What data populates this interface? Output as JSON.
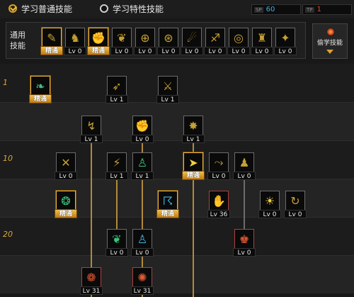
{
  "tabs": [
    {
      "label": "学习普通技能",
      "selected": true
    },
    {
      "label": "学习特性技能",
      "selected": false
    }
  ],
  "points": [
    {
      "tag": "SP",
      "value": "60",
      "color": "#4aa8e0"
    },
    {
      "tag": "TP",
      "value": "1",
      "color": "#e04a2a"
    }
  ],
  "general": {
    "title": "通用技能",
    "skills": [
      {
        "icon": "scroll-pen-icon",
        "glyph": "✎",
        "label": "精通",
        "mastered": true
      },
      {
        "icon": "flame-knight-icon",
        "glyph": "♞",
        "label": "Lv 0"
      },
      {
        "icon": "fist-strike-icon",
        "glyph": "✊",
        "label": "精通",
        "mastered": true
      },
      {
        "icon": "phoenix-icon",
        "glyph": "❦",
        "label": "Lv 0"
      },
      {
        "icon": "target-icon",
        "glyph": "⊕",
        "label": "Lv 0"
      },
      {
        "icon": "crosshair-icon",
        "glyph": "⊛",
        "label": "Lv 0"
      },
      {
        "icon": "leap-icon",
        "glyph": "☄",
        "label": "Lv 0"
      },
      {
        "icon": "runner-icon",
        "glyph": "♐",
        "label": "Lv 0"
      },
      {
        "icon": "spiral-icon",
        "glyph": "◎",
        "label": "Lv 0"
      },
      {
        "icon": "warrior-icon",
        "glyph": "♜",
        "label": "Lv 0"
      },
      {
        "icon": "aura-man-icon",
        "glyph": "✦",
        "label": "Lv 0"
      }
    ]
  },
  "steal": {
    "label": "偷学技能"
  },
  "levels": [
    "1",
    "10",
    "20"
  ],
  "tree": [
    {
      "icon": "leaf-spirit-icon",
      "glyph": "❧",
      "label": "精通",
      "mastered": true,
      "tone": "gr"
    },
    {
      "icon": "kick-icon",
      "glyph": "➶",
      "label": "Lv 1",
      "tone": "g"
    },
    {
      "icon": "slash-icon",
      "glyph": "⚔",
      "label": "Lv 1",
      "tone": "g"
    },
    {
      "icon": "wind-kick-icon",
      "glyph": "↯",
      "label": "Lv 1",
      "tone": "g"
    },
    {
      "icon": "uppercut-icon",
      "glyph": "✊",
      "label": "Lv 0",
      "tone": "g"
    },
    {
      "icon": "burst-icon",
      "glyph": "✸",
      "label": "Lv 1",
      "tone": "g"
    },
    {
      "icon": "cross-strike-icon",
      "glyph": "✕",
      "label": "Lv 0",
      "tone": "g"
    },
    {
      "icon": "lightning-icon",
      "glyph": "⚡",
      "label": "Lv 1",
      "tone": "g"
    },
    {
      "icon": "body-power-icon",
      "glyph": "♙",
      "label": "Lv 1",
      "tone": "gr"
    },
    {
      "icon": "dash-icon",
      "glyph": "➤",
      "label": "精通",
      "mastered": true,
      "tone": "yl"
    },
    {
      "icon": "slide-icon",
      "glyph": "⤳",
      "label": "Lv 0",
      "tone": "g"
    },
    {
      "icon": "grab-icon",
      "glyph": "♟",
      "label": "Lv 0",
      "tone": "g"
    },
    {
      "icon": "energy-wave-icon",
      "glyph": "❂",
      "label": "精通",
      "mastered": true,
      "tone": "gr"
    },
    {
      "icon": "wind-slash-icon",
      "glyph": "☈",
      "label": "精通",
      "mastered": true,
      "tone": "bl"
    },
    {
      "icon": "fire-punch-icon",
      "glyph": "✋",
      "label": "Lv 36",
      "red": true,
      "tone": "rd"
    },
    {
      "icon": "fire-beam-icon",
      "glyph": "☀",
      "label": "Lv 0",
      "tone": "yl"
    },
    {
      "icon": "whirl-icon",
      "glyph": "↻",
      "label": "Lv 0",
      "tone": "g"
    },
    {
      "icon": "green-flame-icon",
      "glyph": "❦",
      "label": "Lv 0",
      "tone": "gr"
    },
    {
      "icon": "aura-body-icon",
      "glyph": "♙",
      "label": "Lv 0",
      "tone": "bl"
    },
    {
      "icon": "red-warrior-icon",
      "glyph": "♚",
      "label": "Lv 0",
      "red": true,
      "tone": "rd"
    },
    {
      "icon": "flame-spin-icon",
      "glyph": "❁",
      "label": "Lv 31",
      "red": true,
      "tone": "rd"
    },
    {
      "icon": "flame-burst-icon",
      "glyph": "✺",
      "label": "Lv 31",
      "red": true,
      "tone": "rd"
    }
  ]
}
